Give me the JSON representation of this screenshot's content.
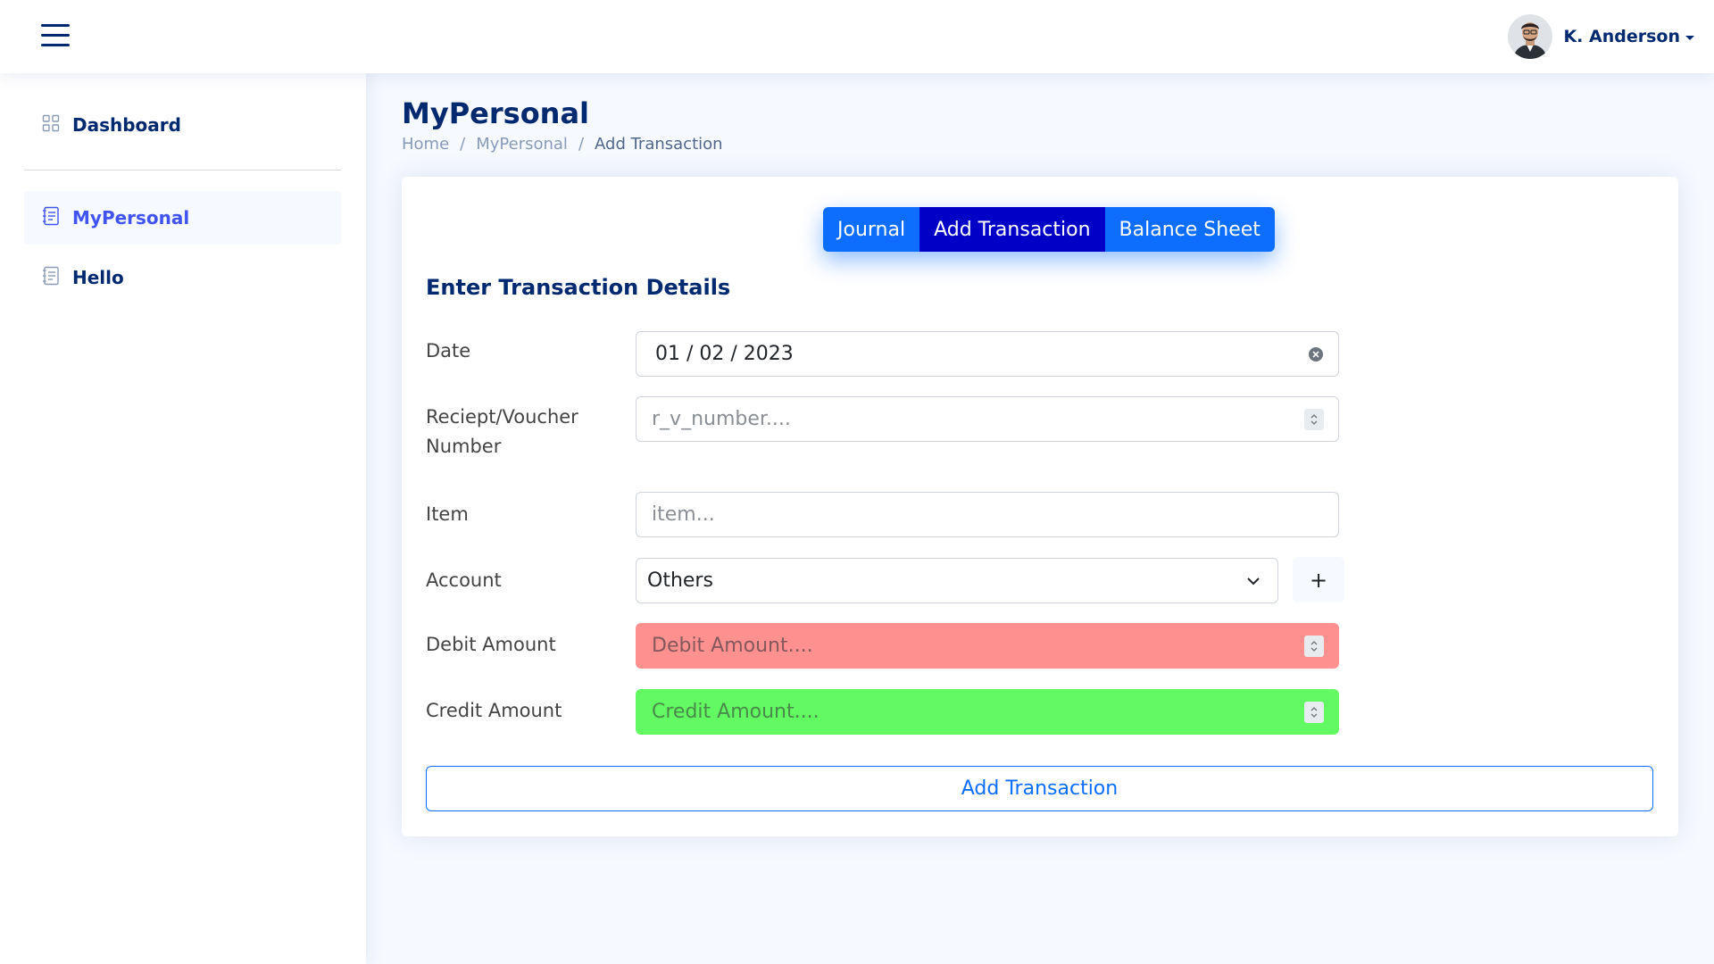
{
  "header": {
    "user_name": "K. Anderson"
  },
  "sidebar": {
    "items": [
      {
        "label": "Dashboard",
        "icon": "grid-icon"
      },
      {
        "label": "MyPersonal",
        "icon": "journal-text-icon"
      },
      {
        "label": "Hello",
        "icon": "journal-text-icon"
      }
    ]
  },
  "page": {
    "title": "MyPersonal",
    "breadcrumb": [
      "Home",
      "MyPersonal",
      "Add Transaction"
    ]
  },
  "tabs": [
    "Journal",
    "Add Transaction",
    "Balance Sheet"
  ],
  "active_tab": "Add Transaction",
  "form": {
    "title": "Enter Transaction Details",
    "date": {
      "label": "Date",
      "value": "01 / 02 / 2023"
    },
    "voucher": {
      "label_line1": "Reciept/Voucher",
      "label_line2": "Number",
      "placeholder": "r_v_number...."
    },
    "item": {
      "label": "Item",
      "placeholder": "item..."
    },
    "account": {
      "label": "Account",
      "value": "Others",
      "add_label": "+"
    },
    "debit": {
      "label": "Debit Amount",
      "placeholder": "Debit Amount....",
      "bg_color": "#ff9090"
    },
    "credit": {
      "label": "Credit Amount",
      "placeholder": "Credit Amount....",
      "bg_color": "#62f962"
    },
    "submit_label": "Add Transaction"
  },
  "colors": {
    "primary": "#0d6efd",
    "active_tab": "#0000c6",
    "navy": "#012970"
  }
}
